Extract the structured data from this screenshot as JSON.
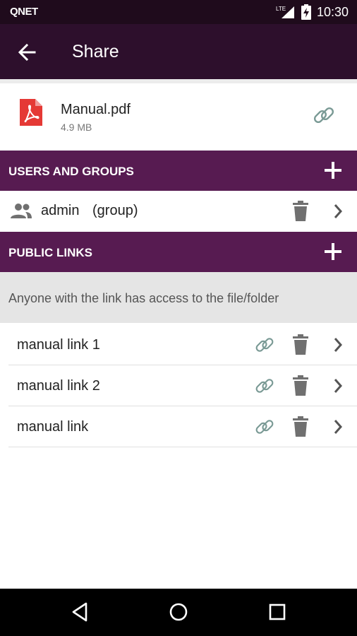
{
  "status_bar": {
    "carrier": "QNET",
    "network": "LTE",
    "time": "10:30"
  },
  "app_bar": {
    "title": "Share",
    "back_icon": "arrow-back-icon"
  },
  "file": {
    "name": "Manual.pdf",
    "size": "4.9 MB",
    "type_icon": "pdf-icon",
    "link_icon": "link-icon"
  },
  "users_section": {
    "title": "USERS AND GROUPS",
    "add_icon": "plus-icon",
    "items": [
      {
        "name": "admin",
        "type": "(group)",
        "icon": "group-icon"
      }
    ]
  },
  "public_links_section": {
    "title": "PUBLIC LINKS",
    "add_icon": "plus-icon",
    "info": "Anyone with the link has access to the file/folder",
    "items": [
      {
        "name": "manual link 1"
      },
      {
        "name": "manual link 2"
      },
      {
        "name": "manual link"
      }
    ]
  },
  "colors": {
    "status_bar": "#1f0b1c",
    "app_bar": "#2d0f2c",
    "section_header": "#571b51",
    "info_banner": "#e5e5e5",
    "pdf_red": "#e53935",
    "link_icon": "#7a9a95",
    "action_icon": "#707070"
  }
}
